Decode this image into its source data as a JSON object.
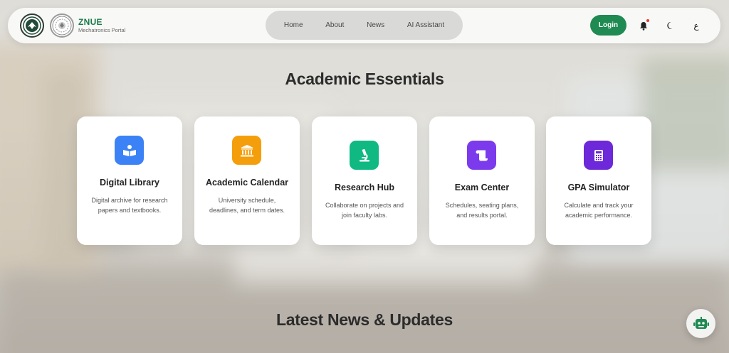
{
  "brand": {
    "title": "ZNUE",
    "subtitle": "Mechatronics Portal"
  },
  "nav": {
    "links": [
      {
        "label": "Home"
      },
      {
        "label": "About"
      },
      {
        "label": "News"
      },
      {
        "label": "AI Assistant"
      }
    ],
    "login_label": "Login",
    "language_label": "ع"
  },
  "sections": {
    "essentials_title": "Academic Essentials",
    "news_title": "Latest News & Updates"
  },
  "cards": [
    {
      "title": "Digital Library",
      "description": "Digital archive for research papers and textbooks.",
      "icon": "book-reader-icon",
      "color": "#3b82f6"
    },
    {
      "title": "Academic Calendar",
      "description": "University schedule, deadlines, and term dates.",
      "icon": "university-icon",
      "color": "#f59e0b"
    },
    {
      "title": "Research Hub",
      "description": "Collaborate on projects and join faculty labs.",
      "icon": "microscope-icon",
      "color": "#10b981"
    },
    {
      "title": "Exam Center",
      "description": "Schedules, seating plans, and results portal.",
      "icon": "scroll-icon",
      "color": "#7c3aed"
    },
    {
      "title": "GPA Simulator",
      "description": "Calculate and track your academic performance.",
      "icon": "calculator-icon",
      "color": "#6d28d9"
    }
  ],
  "colors": {
    "brand_green": "#1f8a52",
    "notification_dot": "#e53935"
  }
}
